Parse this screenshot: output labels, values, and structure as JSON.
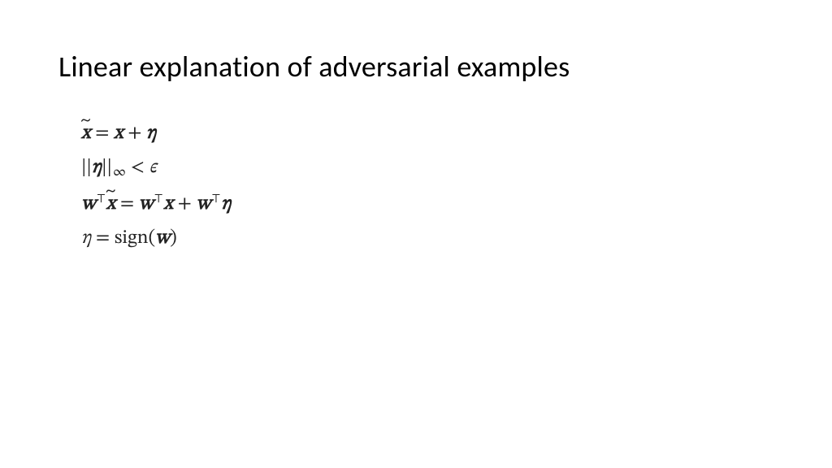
{
  "slide": {
    "title": "Linear explanation of adversarial examples",
    "equations": {
      "eq1": {
        "lhs_xtilde": "x",
        "eq": " = ",
        "rhs_x": "x",
        "plus": " + ",
        "rhs_eta": "η"
      },
      "eq2": {
        "lbar1": "||",
        "eta": "η",
        "lbar2": "||",
        "inf": "∞",
        "lt": " < ",
        "eps": "ϵ"
      },
      "eq3": {
        "w1": "w",
        "T1": "⊤",
        "xt": "x",
        "eq": " = ",
        "w2": "w",
        "T2": "⊤",
        "x": "x",
        "plus": " + ",
        "w3": "w",
        "T3": "⊤",
        "eta": "η"
      },
      "eq4": {
        "eta": "η",
        "eq": " = ",
        "sign": "sign",
        "lp": "(",
        "w": "w",
        "rp": ")"
      }
    }
  }
}
